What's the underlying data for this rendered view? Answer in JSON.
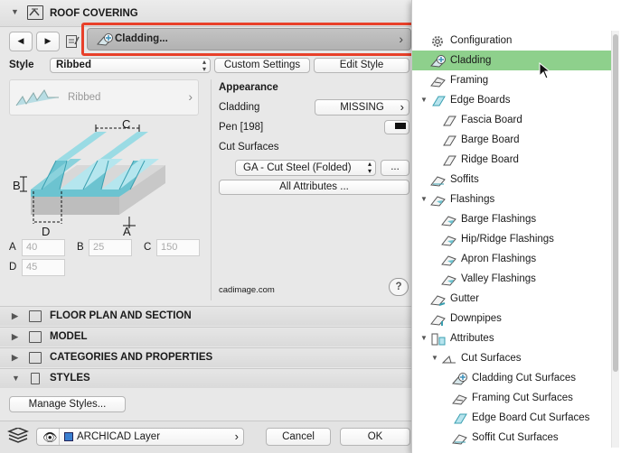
{
  "header": {
    "title": "ROOF COVERING"
  },
  "dropdown": {
    "label": "Cladding...",
    "chevron": "›"
  },
  "style": {
    "label": "Style",
    "value": "Ribbed",
    "custom_settings": "Custom Settings",
    "edit_style": "Edit Style"
  },
  "preview": {
    "label": "Ribbed",
    "chevron": "›"
  },
  "diagram": {
    "label_a": "A",
    "label_b": "B",
    "label_c": "C",
    "label_d": "D"
  },
  "dimensions": {
    "a_label": "A",
    "a_value": "40",
    "b_label": "B",
    "b_value": "25",
    "c_label": "C",
    "c_value": "150",
    "d_label": "D",
    "d_value": "45"
  },
  "appearance": {
    "title": "Appearance",
    "cladding_label": "Cladding",
    "cladding_value": "MISSING",
    "pen_label": "Pen [198]",
    "cut_surfaces_label": "Cut Surfaces",
    "cut_surfaces_value": "GA - Cut Steel (Folded)",
    "more_button": "...",
    "all_attributes": "All Attributes ..."
  },
  "footer_text": "cadimage.com",
  "help": "?",
  "sections": [
    {
      "label": "FLOOR PLAN AND SECTION",
      "expanded": false
    },
    {
      "label": "MODEL",
      "expanded": false
    },
    {
      "label": "CATEGORIES AND PROPERTIES",
      "expanded": false
    },
    {
      "label": "STYLES",
      "expanded": true
    }
  ],
  "manage_styles": "Manage Styles...",
  "bottom": {
    "layer": "ARCHICAD Layer",
    "cancel": "Cancel",
    "ok": "OK"
  },
  "menu": {
    "selected_index": 1,
    "items": [
      {
        "label": "Configuration",
        "icon": "gear-icon",
        "level": 0
      },
      {
        "label": "Cladding",
        "icon": "cladding-icon",
        "level": 0
      },
      {
        "label": "Framing",
        "icon": "framing-icon",
        "level": 0
      },
      {
        "label": "Edge Boards",
        "icon": "edge-board-icon",
        "level": 0,
        "expanded": true
      },
      {
        "label": "Fascia Board",
        "icon": "board-icon",
        "level": 1
      },
      {
        "label": "Barge Board",
        "icon": "board-icon",
        "level": 1
      },
      {
        "label": "Ridge Board",
        "icon": "board-icon",
        "level": 1
      },
      {
        "label": "Soffits",
        "icon": "soffit-icon",
        "level": 0
      },
      {
        "label": "Flashings",
        "icon": "flashing-icon",
        "level": 0,
        "expanded": true
      },
      {
        "label": "Barge Flashings",
        "icon": "flashing-icon",
        "level": 1
      },
      {
        "label": "Hip/Ridge Flashings",
        "icon": "flashing-icon",
        "level": 1
      },
      {
        "label": "Apron Flashings",
        "icon": "flashing-icon",
        "level": 1
      },
      {
        "label": "Valley Flashings",
        "icon": "flashing-icon",
        "level": 1
      },
      {
        "label": "Gutter",
        "icon": "gutter-icon",
        "level": 0
      },
      {
        "label": "Downpipes",
        "icon": "downpipe-icon",
        "level": 0
      },
      {
        "label": "Attributes",
        "icon": "attributes-icon",
        "level": 0,
        "expanded": true
      },
      {
        "label": "Cut Surfaces",
        "icon": "cut-surfaces-icon",
        "level": 1,
        "expanded": true
      },
      {
        "label": "Cladding Cut Surfaces",
        "icon": "cladding-icon",
        "level": 2
      },
      {
        "label": "Framing Cut Surfaces",
        "icon": "framing-icon",
        "level": 2
      },
      {
        "label": "Edge Board Cut Surfaces",
        "icon": "edge-board-icon",
        "level": 2
      },
      {
        "label": "Soffit Cut Surfaces",
        "icon": "soffit-icon",
        "level": 2
      }
    ]
  }
}
